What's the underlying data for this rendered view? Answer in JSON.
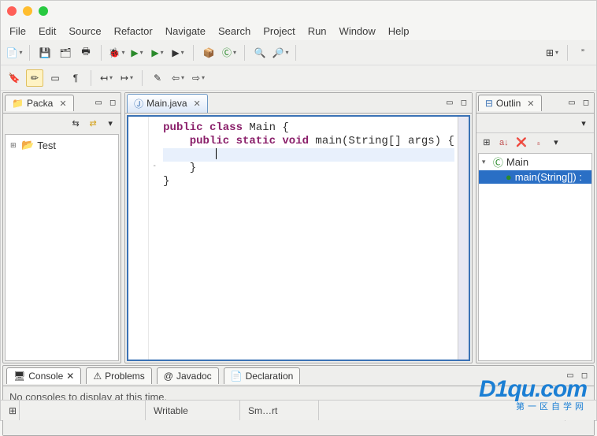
{
  "menu": [
    "File",
    "Edit",
    "Source",
    "Refactor",
    "Navigate",
    "Search",
    "Project",
    "Run",
    "Window",
    "Help"
  ],
  "package_explorer": {
    "title": "Packa",
    "items": [
      {
        "label": "Test"
      }
    ]
  },
  "editor": {
    "tab_label": "Main.java",
    "code_lines": [
      {
        "indent": 0,
        "tokens": []
      },
      {
        "indent": 0,
        "tokens": [
          {
            "t": "public",
            "k": true
          },
          {
            "t": " "
          },
          {
            "t": "class",
            "k": true
          },
          {
            "t": " Main {"
          }
        ]
      },
      {
        "indent": 1,
        "tokens": [
          {
            "t": "public",
            "k": true
          },
          {
            "t": " "
          },
          {
            "t": "static",
            "k": true
          },
          {
            "t": " "
          },
          {
            "t": "void",
            "k": true
          },
          {
            "t": " main(String[] args) {"
          }
        ],
        "fold": "-"
      },
      {
        "indent": 2,
        "tokens": [],
        "current": true
      },
      {
        "indent": 1,
        "tokens": [
          {
            "t": "}"
          }
        ]
      },
      {
        "indent": 0,
        "tokens": []
      },
      {
        "indent": 0,
        "tokens": [
          {
            "t": "}"
          }
        ]
      }
    ]
  },
  "outline": {
    "title": "Outlin",
    "items": [
      {
        "label": "Main",
        "icon": "class",
        "indent": 0,
        "sel": false
      },
      {
        "label": "main(String[]) :",
        "icon": "method",
        "indent": 1,
        "sel": true
      }
    ]
  },
  "bottom": {
    "tabs": [
      "Console",
      "Problems",
      "Javadoc",
      "Declaration"
    ],
    "active": 0,
    "console_msg": "No consoles to display at this time."
  },
  "status": {
    "c1": "",
    "c2": "Writable",
    "c3": "Sm…rt"
  },
  "watermark": {
    "big": "D1qu.com",
    "small": "第一区自学网"
  }
}
